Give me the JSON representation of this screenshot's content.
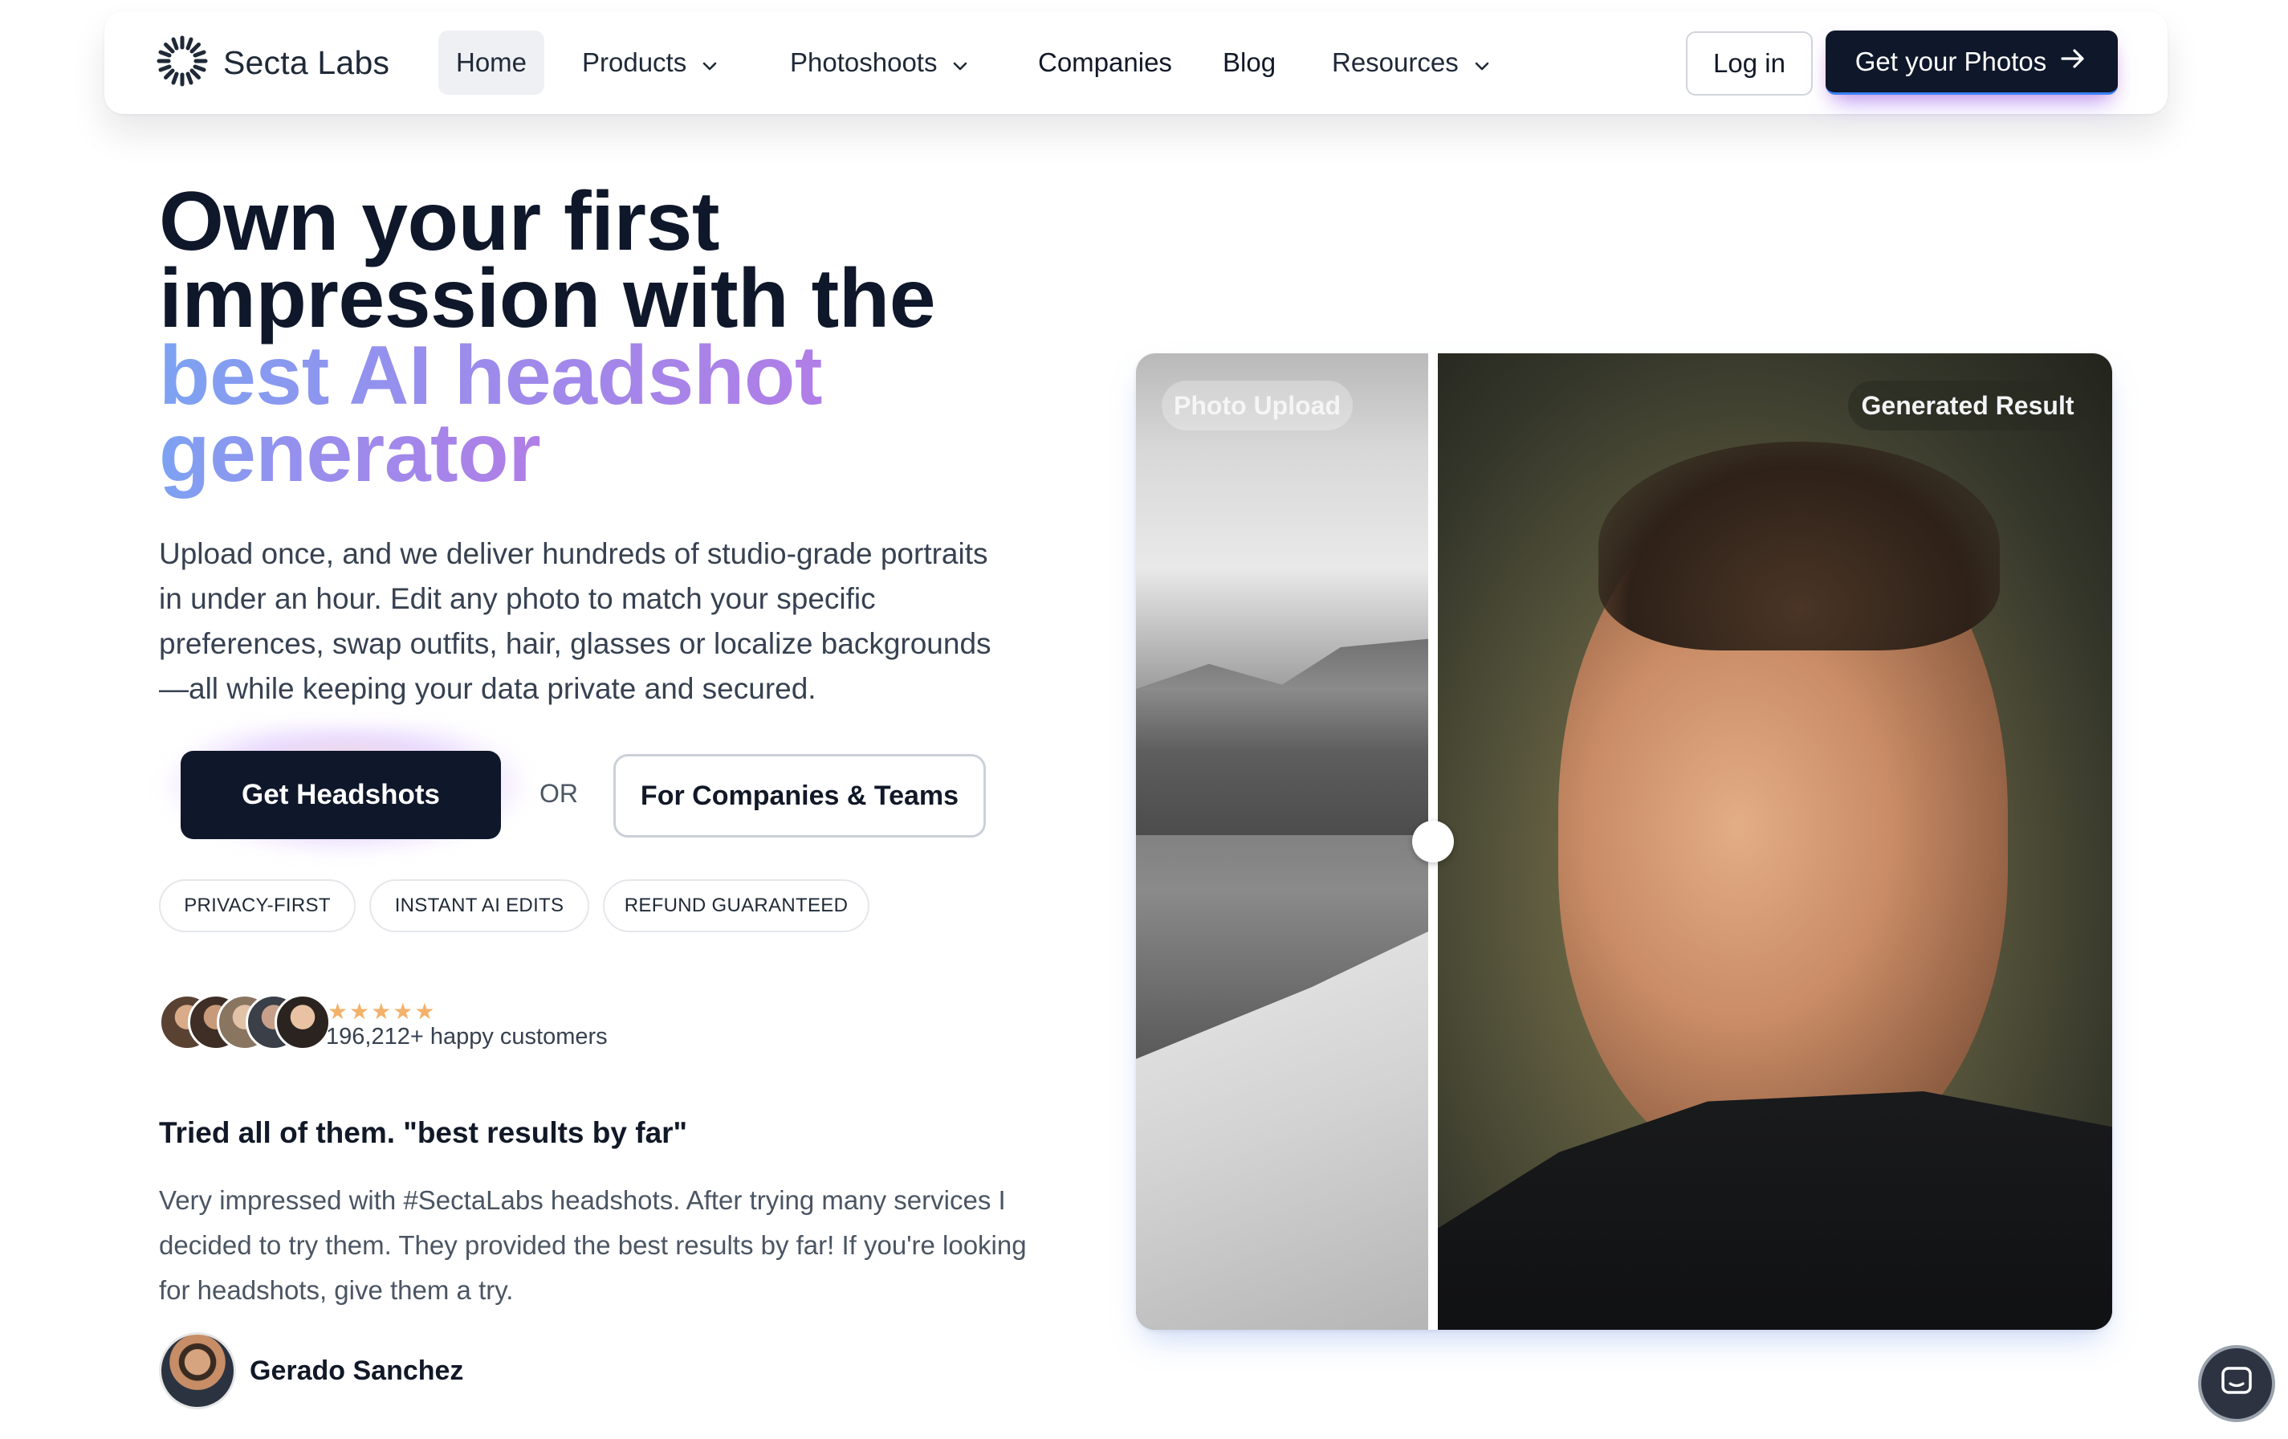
{
  "nav": {
    "logo_text": "Secta Labs",
    "items": [
      {
        "label": "Home"
      },
      {
        "label": "Products"
      },
      {
        "label": "Photoshoots"
      },
      {
        "label": "Companies"
      },
      {
        "label": "Blog"
      },
      {
        "label": "Resources"
      }
    ],
    "login_label": "Log in",
    "cta_label": "Get your Photos"
  },
  "hero": {
    "title_line1": "Own your first",
    "title_line2": "impression with the",
    "title_highlight_1": "best AI headshot",
    "title_highlight_2": "generator",
    "subtitle": "Upload once, and we deliver hundreds of studio-grade portraits in under an hour. Edit any photo to match your specific preferences, swap outfits, hair, glasses or localize backgrounds—all while keeping your data private and secured.",
    "primary_cta": "Get Headshots",
    "or_text": "OR",
    "secondary_cta": "For Companies & Teams",
    "pills": [
      "PRIVACY-FIRST",
      "INSTANT AI EDITS",
      "REFUND GUARANTEED"
    ],
    "stars": "★★★★★",
    "rating": 5,
    "happy_customers": "196,212+ happy customers"
  },
  "testimonial": {
    "title": "Tried all of them. \"best results by far\"",
    "body": "Very impressed with #SectaLabs headshots. After trying many services I decided to try them. They provided the best results by far! If you're looking for headshots, give them a try.",
    "author": "Gerado Sanchez"
  },
  "comparison": {
    "left_label": "Photo Upload",
    "right_label": "Generated Result"
  },
  "colors": {
    "primary": "#0f172a",
    "gradient_start": "#7da2f2",
    "gradient_end": "#b07ee6",
    "star": "#f2b26b"
  },
  "icons": {
    "logo": "sunburst-logo-icon",
    "chevron": "chevron-down-icon",
    "arrow": "arrow-right-icon",
    "chat": "chat-icon"
  }
}
